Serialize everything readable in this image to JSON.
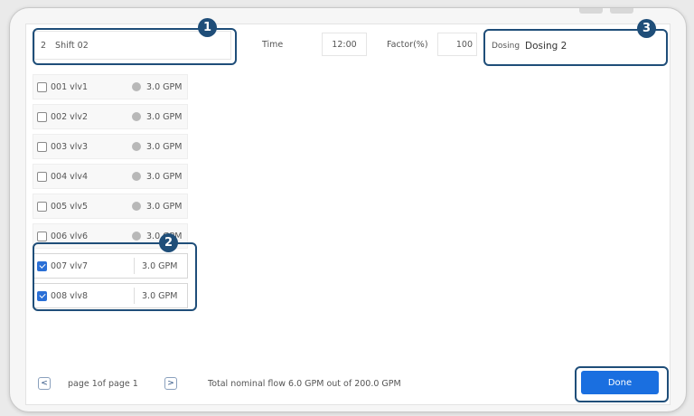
{
  "header": {
    "shift_number": "2",
    "shift_name": "Shift 02",
    "time_label": "Time",
    "time_value": "12:00",
    "factor_label": "Factor(%)",
    "factor_value": "100",
    "dosing_label": "Dosing",
    "dosing_value": "Dosing 2"
  },
  "valves": [
    {
      "label": "001 vlv1",
      "flow": "3.0 GPM",
      "checked": false
    },
    {
      "label": "002 vlv2",
      "flow": "3.0 GPM",
      "checked": false
    },
    {
      "label": "003 vlv3",
      "flow": "3.0 GPM",
      "checked": false
    },
    {
      "label": "004 vlv4",
      "flow": "3.0 GPM",
      "checked": false
    },
    {
      "label": "005 vlv5",
      "flow": "3.0 GPM",
      "checked": false
    },
    {
      "label": "006 vlv6",
      "flow": "3.0 GPM",
      "checked": false
    },
    {
      "label": "007 vlv7",
      "flow": "3.0 GPM",
      "checked": true
    },
    {
      "label": "008 vlv8",
      "flow": "3.0 GPM",
      "checked": true
    }
  ],
  "footer": {
    "prev_glyph": "<",
    "next_glyph": ">",
    "page_text": "page 1of page 1",
    "total_text": "Total nominal flow 6.0 GPM out of 200.0 GPM",
    "done_label": "Done"
  },
  "callouts": [
    "1",
    "2",
    "3"
  ],
  "colors": {
    "accent": "#1a6fe0",
    "callout": "#1f4e79",
    "check": "#2a6fd6"
  }
}
